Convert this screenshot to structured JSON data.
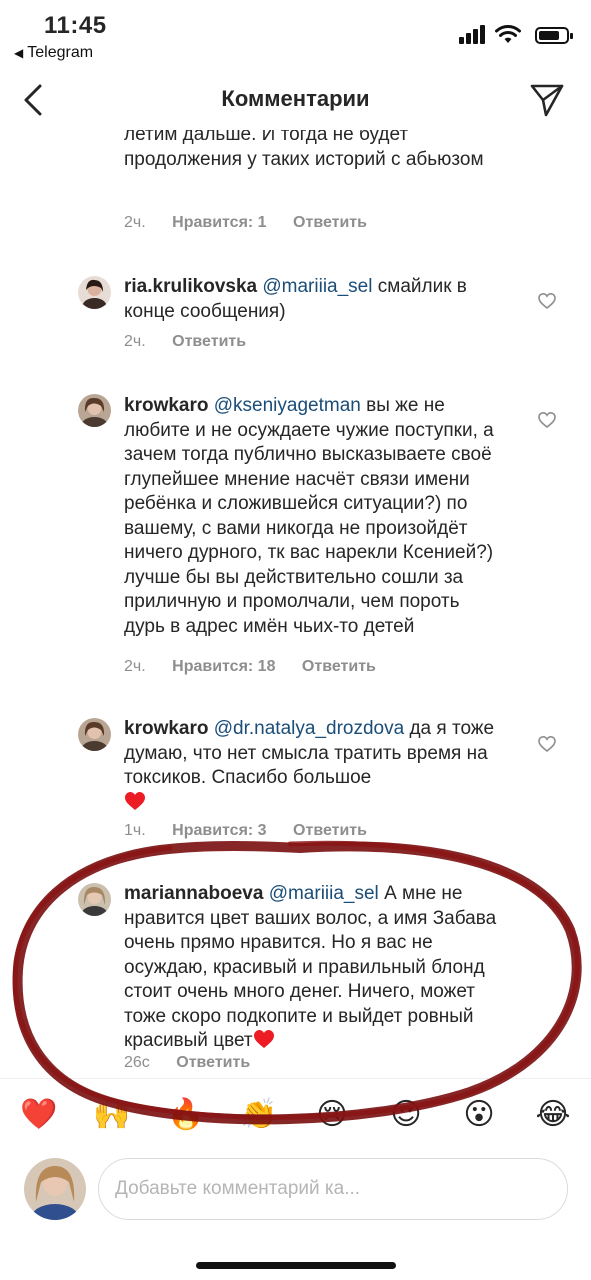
{
  "status_bar": {
    "time": "11:45",
    "back_app_label": "Telegram"
  },
  "header": {
    "title": "Комментарии"
  },
  "comments": [
    {
      "id": "c0",
      "username": "",
      "mention": "",
      "text": "летим дальше. И тогда не будет продолжения у таких историй с абьюзом",
      "time": "2ч.",
      "likes": "Нравится: 1",
      "reply": "Ответить"
    },
    {
      "id": "c1",
      "username": "ria.krulikovska",
      "mention": "@mariiia_sel",
      "text": "смайлик в конце сообщения)",
      "time": "2ч.",
      "likes": "",
      "reply": "Ответить"
    },
    {
      "id": "c2",
      "username": "krowkaro",
      "mention": "@kseniyagetman",
      "text": "вы же не любите и не осуждаете чужие поступки, а зачем тогда публично высказываете своё глупейшее мнение насчёт связи имени ребёнка и сложившейся ситуации?) по вашему, с вами никогда не произойдёт ничего дурного, тк вас нарекли Ксенией?) лучше бы вы действительно сошли за приличную и промолчали, чем пороть дурь в адрес имён чьих-то детей",
      "time": "2ч.",
      "likes": "Нравится: 18",
      "reply": "Ответить"
    },
    {
      "id": "c3",
      "username": "krowkaro",
      "mention": "@dr.natalya_drozdova",
      "text": "да я тоже думаю, что нет смысла тратить время на токсиков. Спасибо большое",
      "time": "1ч.",
      "likes": "Нравится: 3",
      "reply": "Ответить"
    },
    {
      "id": "c4",
      "username": "mariannaboeva",
      "mention": "@mariiia_sel",
      "text": "А мне не нравится цвет ваших волос,  а имя Забава очень прямо нравится. Но я вас не осуждаю, красивый и правильный блонд стоит очень много денег. Ничего, может тоже скоро подкопите и выйдет ровный красивый цвет",
      "time": "26с",
      "likes": "",
      "reply": "Ответить"
    }
  ],
  "reactions": [
    "❤️",
    "🙌",
    "🔥",
    "👏",
    "😢",
    "😍",
    "😮",
    "😂"
  ],
  "composer": {
    "placeholder": "Добавьте комментарий ка..."
  },
  "colors": {
    "mention": "#1a4d78",
    "meta": "#8e8e8e",
    "heart": "#ed1c24",
    "annotation": "#7a0e0e"
  },
  "icons": [
    "back-chevron-icon",
    "send-icon",
    "like-heart-icon",
    "wifi-icon",
    "battery-icon",
    "signal-icon"
  ]
}
